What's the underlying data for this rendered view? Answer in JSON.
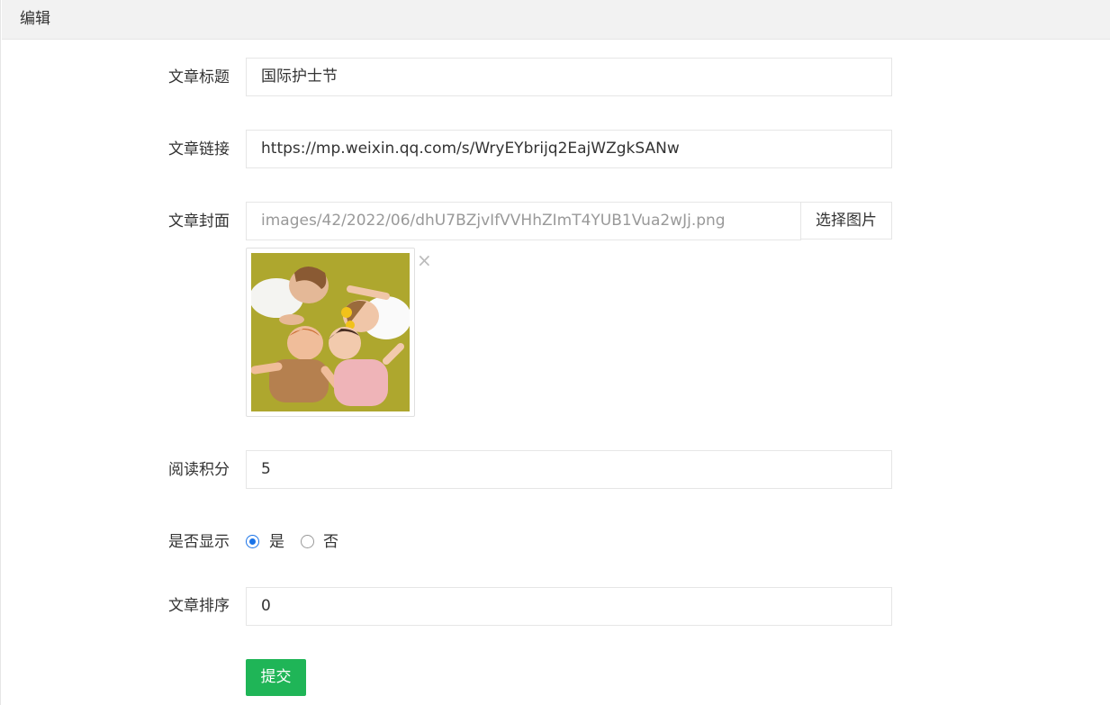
{
  "header": {
    "title": "编辑"
  },
  "form": {
    "title_label": "文章标题",
    "title_value": "国际护士节",
    "link_label": "文章链接",
    "link_value": "https://mp.weixin.qq.com/s/WryEYbrijq2EajWZgkSANw",
    "cover_label": "文章封面",
    "cover_path": "images/42/2022/06/dhU7BZjvIfVVHhZImT4YUB1Vua2wJj.png",
    "cover_button": "选择图片",
    "cover_remove": "×",
    "points_label": "阅读积分",
    "points_value": "5",
    "show_label": "是否显示",
    "show_options": [
      "是",
      "否"
    ],
    "show_selected": "是",
    "sort_label": "文章排序",
    "sort_value": "0",
    "submit_label": "提交"
  },
  "colors": {
    "accent": "#1fb557",
    "radio": "#1a73e8",
    "header_bg": "#f2f2f2",
    "border": "#e6e6e6"
  },
  "icons": {
    "remove": "close-icon"
  }
}
